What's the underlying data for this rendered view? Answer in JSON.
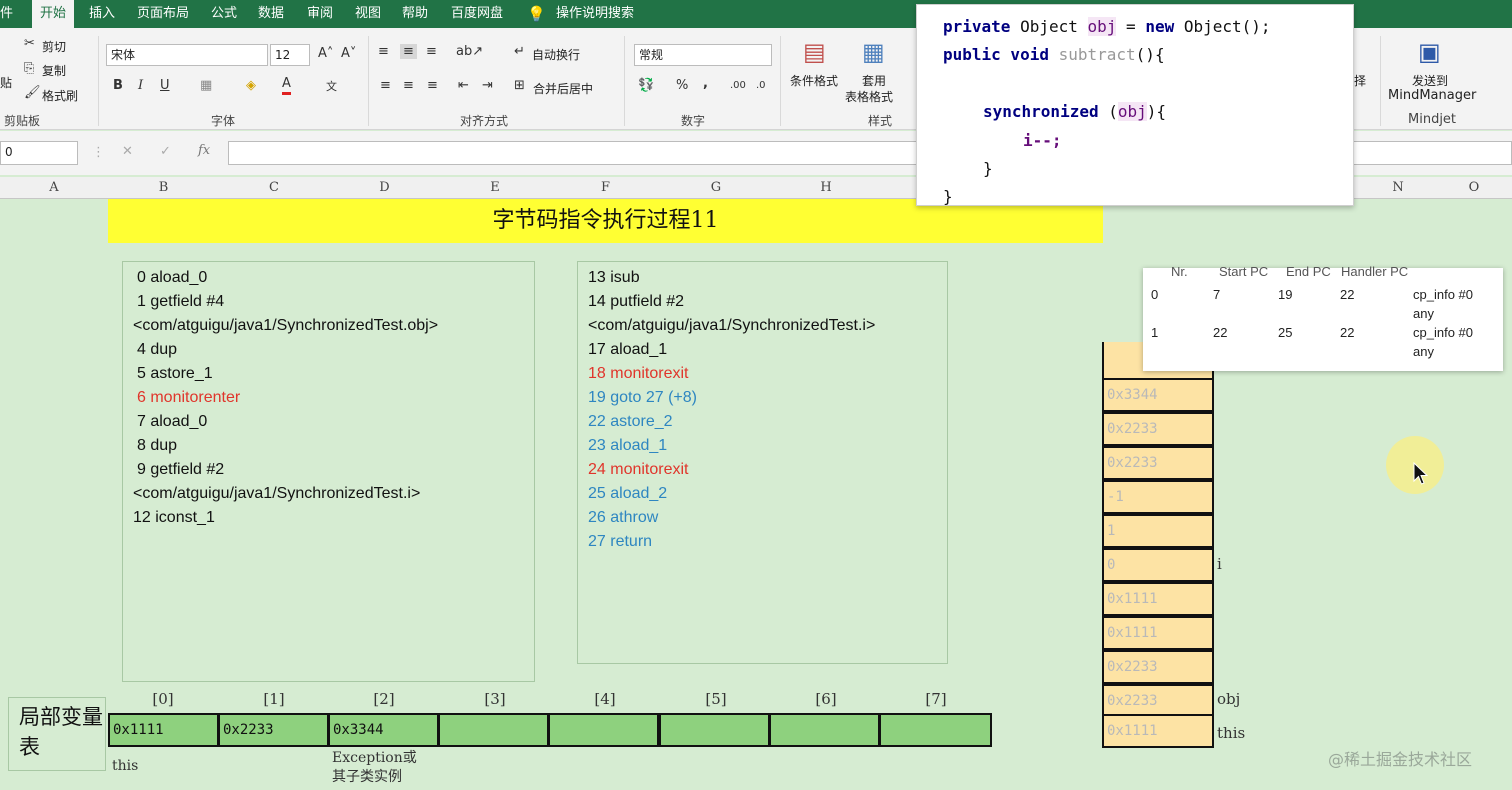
{
  "ribbon_tabs": [
    "件",
    "开始",
    "插入",
    "页面布局",
    "公式",
    "数据",
    "审阅",
    "视图",
    "帮助",
    "百度网盘",
    "操作说明搜索"
  ],
  "clipboard": {
    "cut": "剪切",
    "copy": "复制",
    "format_painter": "格式刷",
    "paste": "贴",
    "group": "剪贴板"
  },
  "font": {
    "name": "宋体",
    "size": "12",
    "group": "字体",
    "bold": "B",
    "italic": "I",
    "underline": "U"
  },
  "alignment": {
    "wrap": "自动换行",
    "merge": "合并后居中",
    "group": "对齐方式"
  },
  "number": {
    "format": "常规",
    "group": "数字",
    "percent": "%",
    "comma": ","
  },
  "styles": {
    "conditional": "条件格式",
    "table_format_1": "套用",
    "table_format_2": "表格格式",
    "group": "样式"
  },
  "mindjet": {
    "send_1": "发送到",
    "send_2": "MindManager",
    "group": "Mindjet",
    "partial": "择"
  },
  "formula_bar": {
    "name_box": "0",
    "fx": "fx"
  },
  "columns": [
    "A",
    "B",
    "C",
    "D",
    "E",
    "F",
    "G",
    "H",
    "N",
    "O"
  ],
  "sheet_title": "字节码指令执行过程11",
  "left_instructions": [
    "0 aload_0",
    "1 getfield #4",
    "<com/atguigu/java1/SynchronizedTest.obj>",
    "4 dup",
    "5 astore_1",
    "6 monitorenter",
    "7 aload_0",
    "8 dup",
    "9 getfield #2",
    "<com/atguigu/java1/SynchronizedTest.i>",
    "12 iconst_1"
  ],
  "right_instructions": [
    "13 isub",
    "14 putfield #2",
    "<com/atguigu/java1/SynchronizedTest.i>",
    "17 aload_1",
    "18 monitorexit",
    "19 goto 27 (+8)",
    "22 astore_2",
    "23 aload_1",
    "24 monitorexit",
    "25 aload_2",
    "26 athrow",
    "27 return"
  ],
  "locals": {
    "label": "局部变量表",
    "indices": [
      "[0]",
      "[1]",
      "[2]",
      "[3]",
      "[4]",
      "[5]",
      "[6]",
      "[7]"
    ],
    "values": [
      "0x1111",
      "0x2233",
      "0x3344",
      "",
      "",
      "",
      "",
      ""
    ],
    "note_this": "this",
    "note_exception_1": "Exception或",
    "note_exception_2": "其子类实例"
  },
  "stack": {
    "cells": [
      "0x3344",
      "0x2233",
      "0x2233",
      "-1",
      "1",
      "0",
      "0x1111",
      "0x1111",
      "0x2233",
      "0x2233",
      "0x1111"
    ],
    "label_i": "i",
    "label_obj": "obj",
    "label_this": "this"
  },
  "code": {
    "line1_kw": "private",
    "line1_rest": " Object ",
    "line1_obj": "obj",
    "line1_eq": " = ",
    "line1_new": "new",
    "line1_end": " Object();",
    "line2_kw": "public void",
    "line2_name": " subtract",
    "line2_end": "(){",
    "line3_kw": "synchronized",
    "line3_open": " (",
    "line3_obj": "obj",
    "line3_close": "){",
    "line4": "i--;",
    "line5": "}",
    "line6": "}"
  },
  "exception_table": {
    "headers": [
      "Nr.",
      "Start PC",
      "End PC",
      "Handler PC",
      ""
    ],
    "rows": [
      [
        "0",
        "7",
        "19",
        "22",
        "cp_info #0",
        "any"
      ],
      [
        "1",
        "22",
        "25",
        "22",
        "cp_info #0",
        "any"
      ]
    ]
  },
  "watermark": "@稀土掘金技术社区"
}
